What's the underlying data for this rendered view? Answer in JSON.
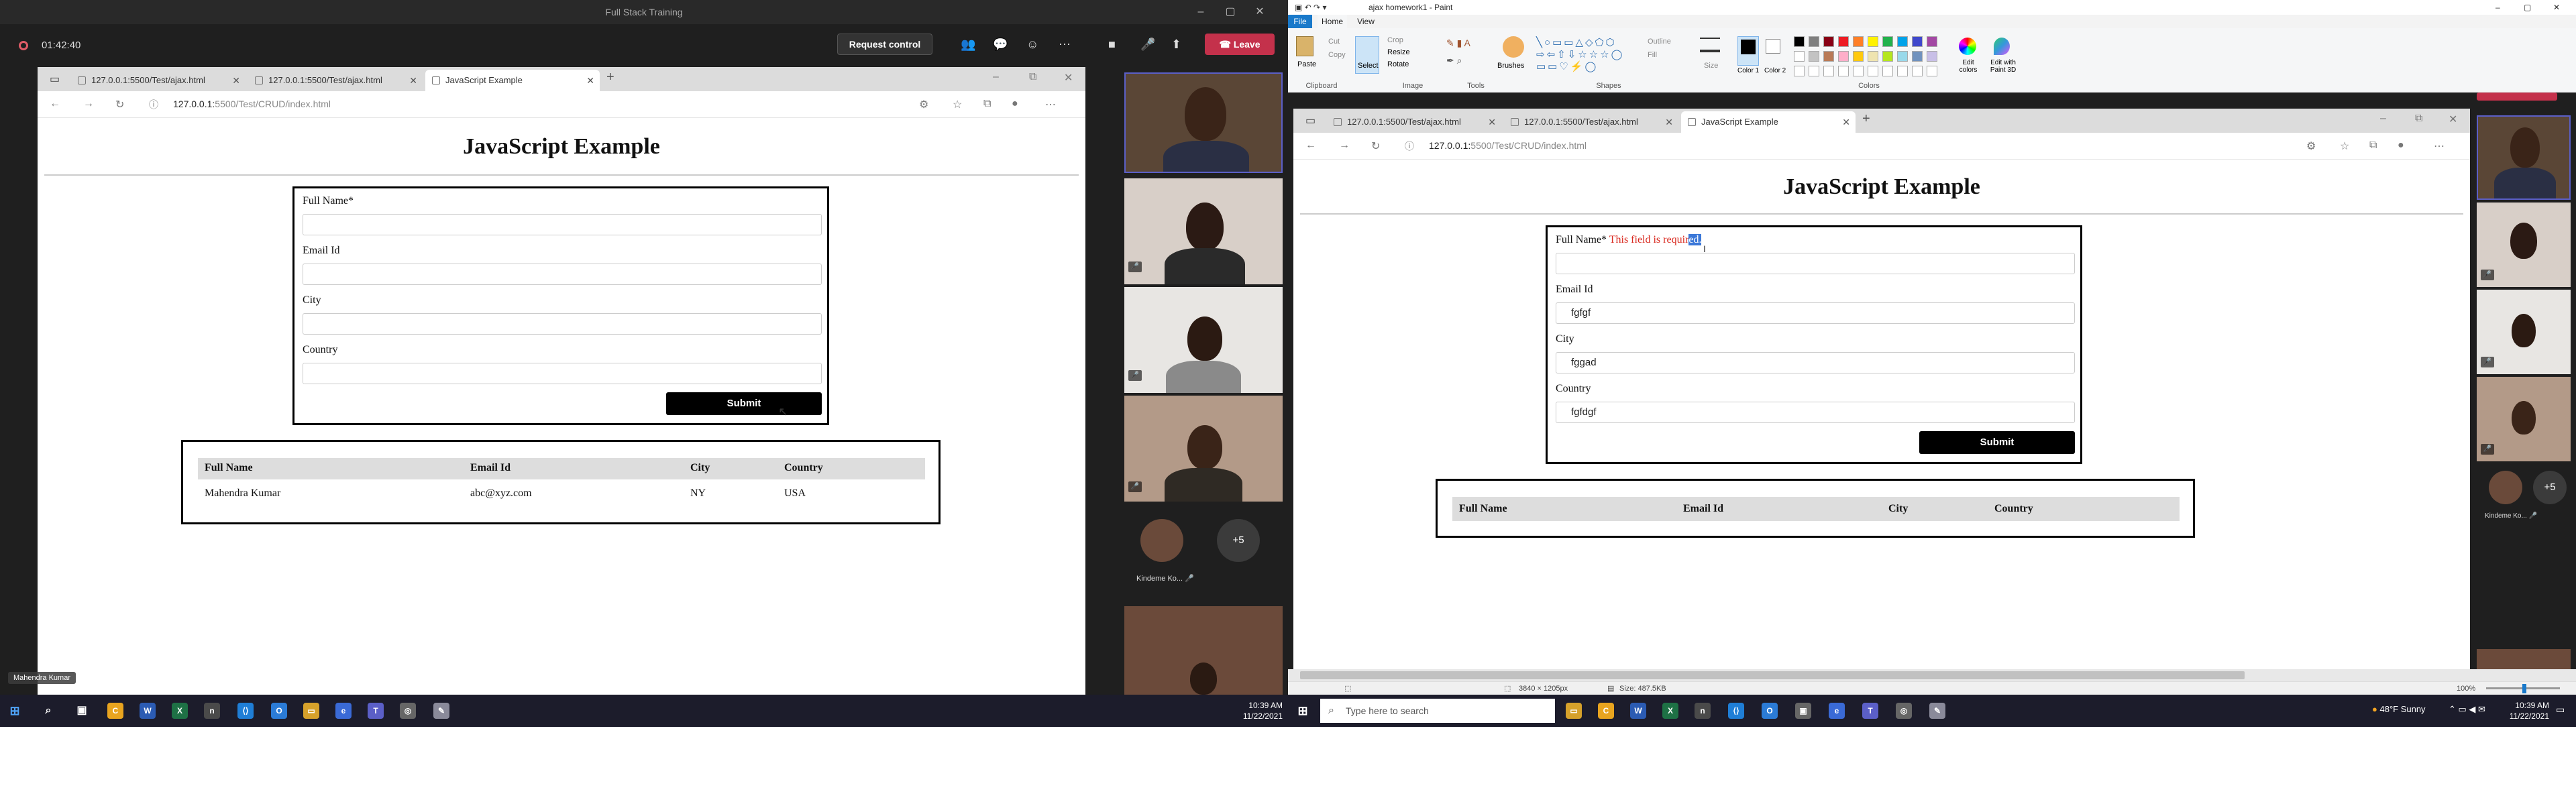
{
  "teams": {
    "window_title": "Full Stack Training",
    "timer": "01:42:40",
    "request_control_label": "Request control",
    "leave_label": "Leave",
    "presenter_name": "Mahendra Kumar",
    "participant_name": "Kindeme Ko...",
    "more_count": "+5"
  },
  "browser_left": {
    "tabs": [
      "127.0.0.1:5500/Test/ajax.html",
      "127.0.0.1:5500/Test/ajax.html",
      "JavaScript Example"
    ],
    "url_host": "127.0.0.1:",
    "url_path": "5500/Test/CRUD/index.html"
  },
  "page_left": {
    "heading": "JavaScript Example",
    "labels": {
      "full_name": "Full Name*",
      "email": "Email Id",
      "city": "City",
      "country": "Country"
    },
    "values": {
      "full_name": "",
      "email": "",
      "city": "",
      "country": ""
    },
    "submit_label": "Submit",
    "table_headers": [
      "Full Name",
      "Email Id",
      "City",
      "Country"
    ],
    "rows": [
      [
        "Mahendra Kumar",
        "abc@xyz.com",
        "NY",
        "USA"
      ]
    ]
  },
  "paint": {
    "title": "ajax homework1 - Paint",
    "menu": [
      "File",
      "Home",
      "View"
    ],
    "groups": [
      "Clipboard",
      "Image",
      "Tools",
      "Shapes",
      "Colors"
    ],
    "tools": {
      "paste": "Paste",
      "cut": "Cut",
      "copy": "Copy",
      "select": "Select",
      "crop": "Crop",
      "resize": "Resize",
      "rotate": "Rotate",
      "brushes": "Brushes",
      "outline": "Outline",
      "fill": "Fill",
      "size": "Size",
      "color1": "Color 1",
      "color2": "Color 2",
      "edit_colors": "Edit colors",
      "edit_paint3d": "Edit with Paint 3D"
    },
    "status_dimensions": "3840 × 1205px",
    "status_size": "Size: 487.5KB",
    "zoom": "100%"
  },
  "browser_right": {
    "tabs": [
      "127.0.0.1:5500/Test/ajax.html",
      "127.0.0.1:5500/Test/ajax.html",
      "JavaScript Example"
    ],
    "url_host": "127.0.0.1:",
    "url_path": "5500/Test/CRUD/index.html"
  },
  "page_right": {
    "heading": "JavaScript Example",
    "labels": {
      "full_name": "Full Name*",
      "email": "Email Id",
      "city": "City",
      "country": "Country"
    },
    "error": "This field is requir",
    "error_selected": "ed.",
    "values": {
      "full_name": "",
      "email": "fgfgf",
      "city": "fggad",
      "country": "fgfdgf"
    },
    "submit_label": "Submit",
    "table_headers": [
      "Full Name",
      "Email Id",
      "City",
      "Country"
    ]
  },
  "taskbar_left": {
    "time": "10:39 AM",
    "date": "11/22/2021"
  },
  "taskbar_right": {
    "search_placeholder": "Type here to search",
    "weather": "48°F  Sunny",
    "time": "10:39 AM",
    "date": "11/22/2021"
  },
  "colors": {
    "teams_bg": "#1f1f1f",
    "leave": "#c4314b",
    "error": "#d9291f",
    "paint_bg": "#c8d1df",
    "taskbar": "#1c1c2b"
  }
}
